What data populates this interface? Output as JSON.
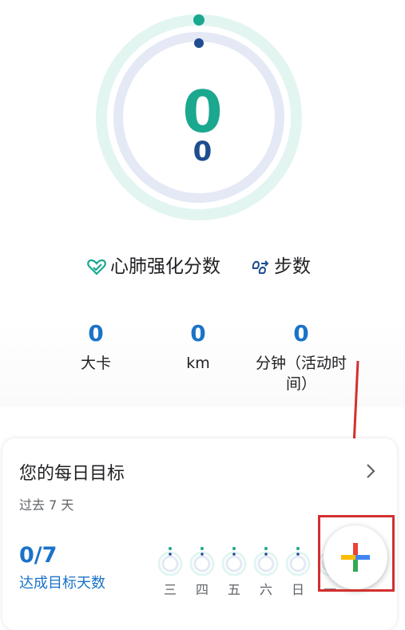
{
  "ring": {
    "main_value": "0",
    "secondary_value": "0"
  },
  "legend": {
    "heart_points_label": "心肺强化分数",
    "steps_label": "步数"
  },
  "stats": [
    {
      "value": "0",
      "label": "大卡"
    },
    {
      "value": "0",
      "label": "km"
    },
    {
      "value": "0",
      "label": "分钟（活动时间）"
    }
  ],
  "goals_card": {
    "title": "您的每日目标",
    "subtitle": "过去 7 天",
    "count": "0/7",
    "count_label": "达成目标天数",
    "days": [
      "三",
      "四",
      "五",
      "六",
      "日",
      "一"
    ]
  },
  "colors": {
    "heart_accent": "#1aa88f",
    "steps_accent": "#1f4e8f",
    "stat_blue": "#1a73c8",
    "annotation": "#d32f2f"
  },
  "fab": {
    "icon": "plus-icon"
  }
}
